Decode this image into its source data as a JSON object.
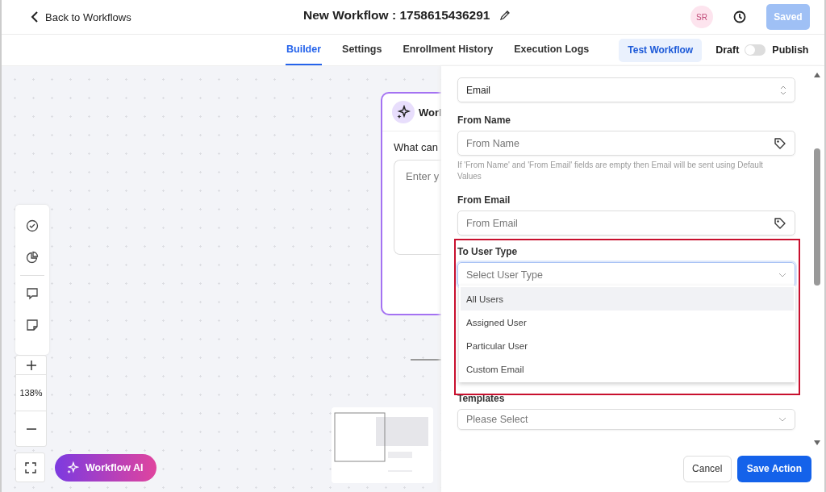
{
  "header": {
    "back_link": "Back to Workflows",
    "title": "New Workflow : 1758615436291",
    "avatar": "SR",
    "save_button": {
      "label": "Saved",
      "disabled": true
    }
  },
  "tabs": [
    {
      "label": "Builder",
      "selected": true
    },
    {
      "label": "Settings",
      "selected": false
    },
    {
      "label": "Enrollment History",
      "selected": false
    },
    {
      "label": "Execution Logs",
      "selected": false
    }
  ],
  "test_button": "Test Workflow",
  "publish_toggle": {
    "off_label": "Draft",
    "on_label": "Publish",
    "on": false
  },
  "canvas": {
    "node": {
      "title": "Worl",
      "prompt": "What can",
      "placeholder": "Enter y"
    },
    "zoom": "138%",
    "ai_button": "Workflow AI"
  },
  "panel": {
    "type_select": {
      "value": "Email"
    },
    "from_name": {
      "label": "From Name",
      "placeholder": "From Name",
      "hint": "If 'From Name' and 'From Email' fields are empty then Email will be sent using Default Values"
    },
    "from_email": {
      "label": "From Email",
      "placeholder": "From Email"
    },
    "to_user_type": {
      "label": "To User Type",
      "placeholder": "Select User Type",
      "options": [
        {
          "label": "All Users",
          "selected": true
        },
        {
          "label": "Assigned User",
          "selected": false
        },
        {
          "label": "Particular User",
          "selected": false
        },
        {
          "label": "Custom Email",
          "selected": false
        }
      ]
    },
    "templates": {
      "label": "Templates",
      "placeholder": "Please Select"
    }
  },
  "footer": {
    "cancel": "Cancel",
    "save": "Save Action"
  }
}
